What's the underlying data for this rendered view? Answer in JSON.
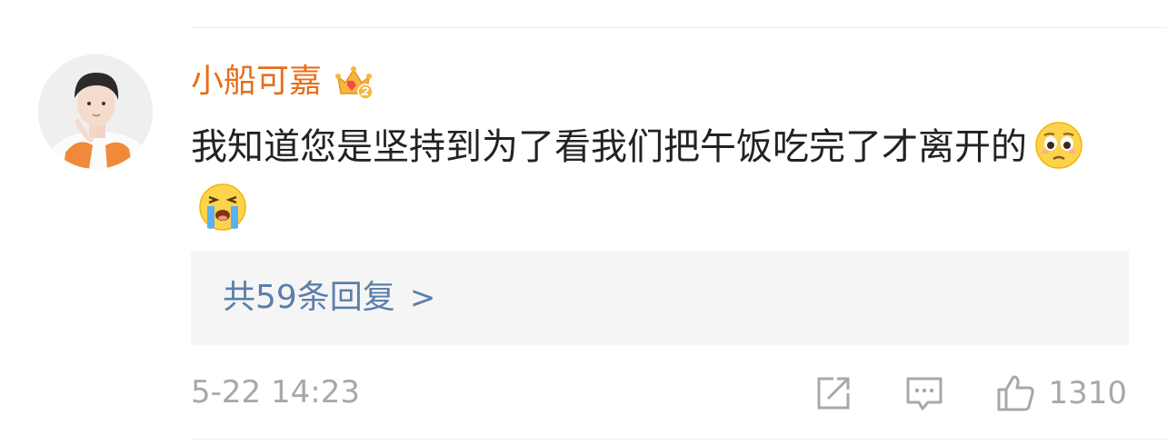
{
  "comment": {
    "username": "小船可嘉",
    "badge_icon": "crown-badge-icon",
    "text": "我知道您是坚持到为了看我们把午饭吃完了才离开的",
    "emojis": [
      "pleading-face-emoji",
      "loudly-crying-emoji"
    ],
    "reply_link": "共59条回复",
    "reply_chevron": ">",
    "timestamp": "5-22 14:23",
    "actions": {
      "share_icon": "share-icon",
      "comment_icon": "comment-icon",
      "like_icon": "thumbs-up-icon",
      "like_count": "1310"
    }
  },
  "colors": {
    "username": "#e86d19",
    "link": "#5b7faa",
    "meta": "#a8a8a8",
    "text": "#222222",
    "reply_bg": "#f5f5f5"
  }
}
